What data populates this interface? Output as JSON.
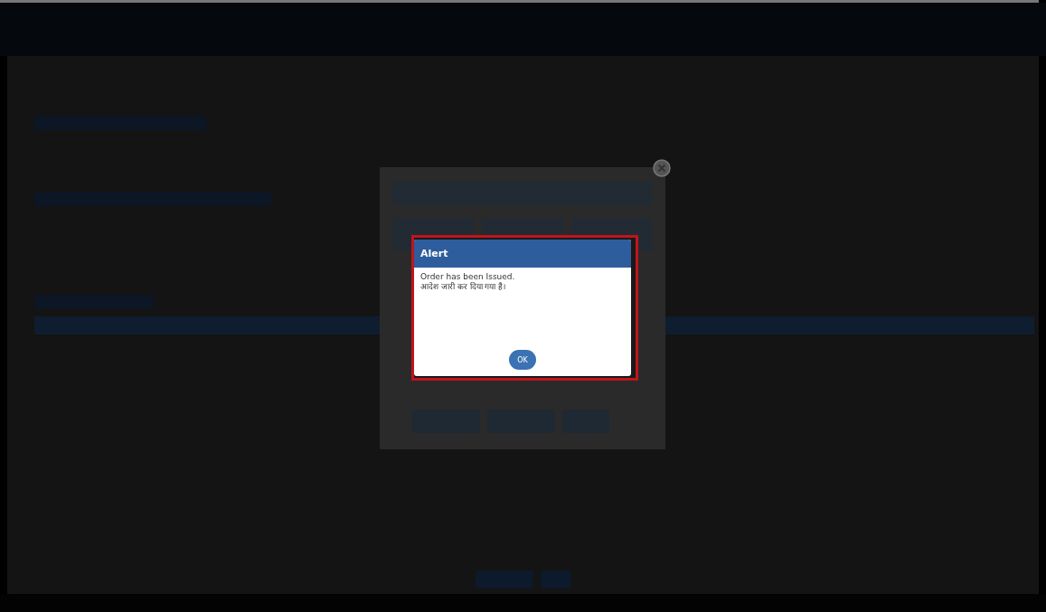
{
  "alert": {
    "title": "Alert",
    "message_lines": [
      "Order has been Issued.",
      "आदेश जारी कर दिया गया है।"
    ],
    "ok_button": "OK"
  }
}
